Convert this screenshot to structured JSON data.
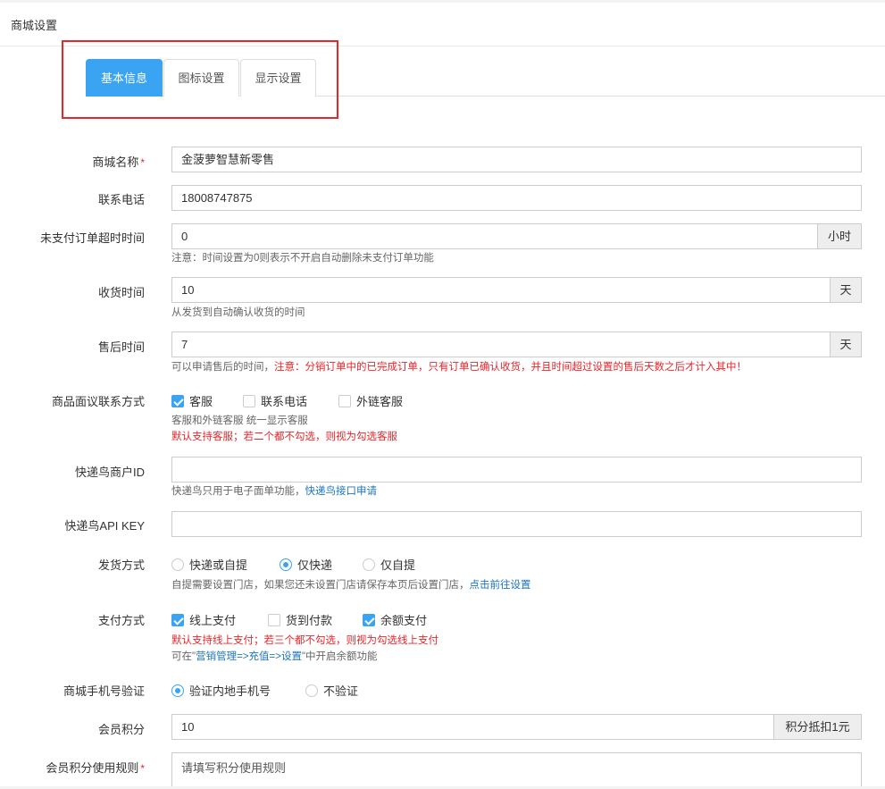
{
  "page": {
    "title": "商城设置"
  },
  "tabs": [
    {
      "label": "基本信息",
      "active": true
    },
    {
      "label": "图标设置",
      "active": false
    },
    {
      "label": "显示设置",
      "active": false
    }
  ],
  "form": {
    "shop_name": {
      "label": "商城名称",
      "required": "*",
      "value": "金菠萝智慧新零售"
    },
    "phone": {
      "label": "联系电话",
      "value": "18008747875"
    },
    "unpaid_timeout": {
      "label": "未支付订单超时时间",
      "value": "0",
      "unit": "小时",
      "help": "注意：时间设置为0则表示不开启自动删除未支付订单功能"
    },
    "receive_time": {
      "label": "收货时间",
      "value": "10",
      "unit": "天",
      "help": "从发货到自动确认收货的时间"
    },
    "after_sale": {
      "label": "售后时间",
      "value": "7",
      "unit": "天",
      "help_prefix": "可以申请售后的时间，",
      "help_red": "注意：分销订单中的已完成订单，只有订单已确认收货，并且时间超过设置的售后天数之后才计入其中！"
    },
    "contact_method": {
      "label": "商品面议联系方式",
      "options": [
        {
          "label": "客服",
          "checked": true
        },
        {
          "label": "联系电话",
          "checked": false
        },
        {
          "label": "外链客服",
          "checked": false
        }
      ],
      "help1": "客服和外链客服 统一显示客服",
      "help2": "默认支持客服；若二个都不勾选，则视为勾选客服"
    },
    "kdn_id": {
      "label": "快递鸟商户ID",
      "value": "",
      "help_prefix": "快递鸟只用于电子面单功能，",
      "help_link": "快递鸟接口申请"
    },
    "kdn_key": {
      "label": "快递鸟API KEY",
      "value": ""
    },
    "delivery": {
      "label": "发货方式",
      "options": [
        {
          "label": "快递或自提",
          "checked": false
        },
        {
          "label": "仅快递",
          "checked": true
        },
        {
          "label": "仅自提",
          "checked": false
        }
      ],
      "help_prefix": "自提需要设置门店，如果您还未设置门店请保存本页后设置门店，",
      "help_link": "点击前往设置"
    },
    "payment": {
      "label": "支付方式",
      "options": [
        {
          "label": "线上支付",
          "checked": true
        },
        {
          "label": "货到付款",
          "checked": false
        },
        {
          "label": "余额支付",
          "checked": true
        }
      ],
      "help_red": "默认支持线上支付；若三个都不勾选，则视为勾选线上支付",
      "help2_prefix": "可在\"",
      "help2_link": "营销管理=>充值=>设置",
      "help2_suffix": "\"中开启余额功能"
    },
    "phone_verify": {
      "label": "商城手机号验证",
      "options": [
        {
          "label": "验证内地手机号",
          "checked": true
        },
        {
          "label": "不验证",
          "checked": false
        }
      ]
    },
    "points": {
      "label": "会员积分",
      "value": "10",
      "unit": "积分抵扣1元"
    },
    "points_rule": {
      "label": "会员积分使用规则",
      "required": "*",
      "placeholder": "请填写积分使用规则"
    }
  },
  "colors": {
    "accent": "#3aa3f2",
    "highlight": "#e8262b",
    "link": "#1b75bc"
  }
}
